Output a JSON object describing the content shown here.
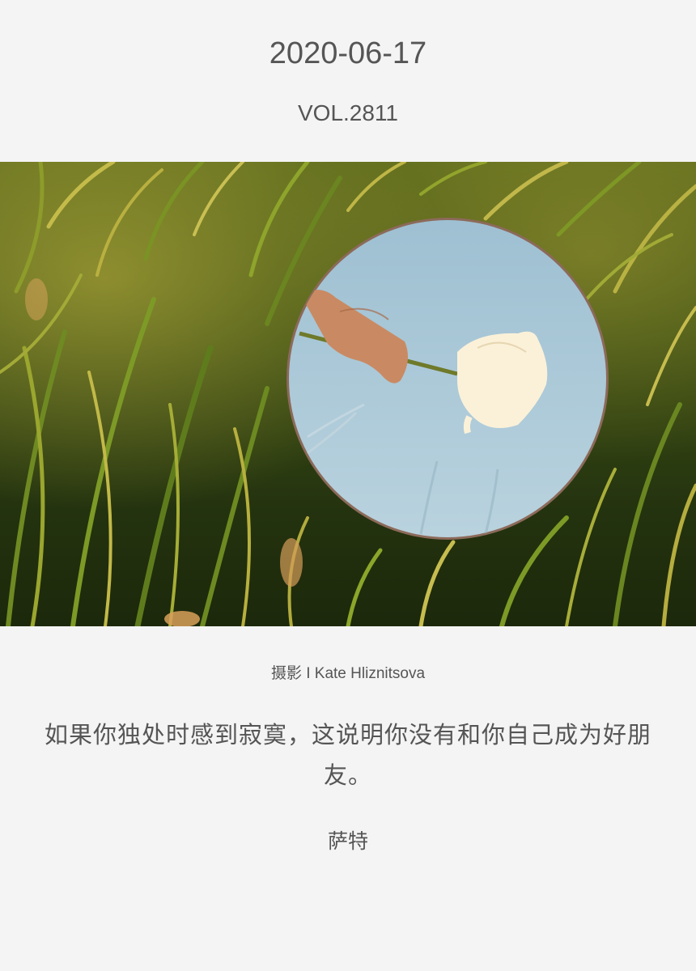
{
  "header": {
    "date": "2020-06-17",
    "volume": "VOL.2811"
  },
  "photo": {
    "subject": "round-mirror-in-grass-reflecting-hand-holding-white-tulip",
    "colors": {
      "grass_dark": "#24300f",
      "grass_light": "#b9b23c",
      "sky": "#a8c6d6",
      "tulip": "#fbf1d8",
      "skin": "#c98a63"
    }
  },
  "credit": "摄影 I Kate Hliznitsova",
  "quote": {
    "text": "如果你独处时感到寂寞，这说明你没有和你自己成为好朋友。",
    "author": "萨特"
  }
}
